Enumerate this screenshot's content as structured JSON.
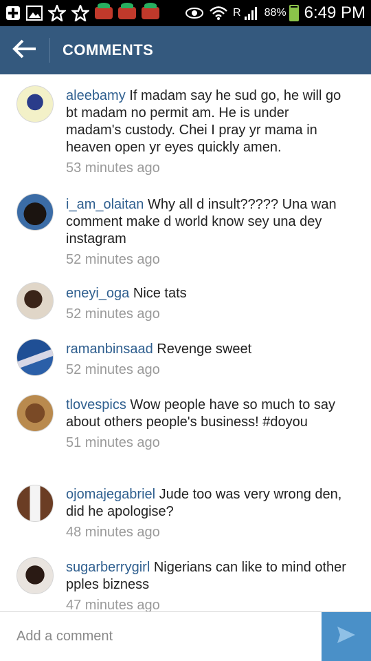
{
  "status_bar": {
    "battery": "88%",
    "battery_level": 0.88,
    "network_label": "R",
    "time": "6:49 PM"
  },
  "header": {
    "title": "COMMENTS"
  },
  "comments": [
    {
      "username": "aleebamy",
      "text": " If madam say he sud go, he will go bt madam no permit am. He is under madam's custody. Chei  I pray yr mama in heaven open yr eyes quickly amen.",
      "time": "53 minutes ago"
    },
    {
      "username": "i_am_olaitan",
      "text": " Why all d insult????? Una wan comment make d world know sey una dey instagram",
      "time": "52 minutes ago"
    },
    {
      "username": "eneyi_oga",
      "text": " Nice tats",
      "time": "52 minutes ago"
    },
    {
      "username": "ramanbinsaad",
      "text": " Revenge sweet",
      "time": "52 minutes ago"
    },
    {
      "username": "tlovespics",
      "text": " Wow people have so much to say about others people's business! #doyou",
      "time": "51 minutes ago"
    },
    {
      "username": "ojomajegabriel",
      "text": " Jude too was very wrong den, did he apologise?",
      "time": "48 minutes ago"
    },
    {
      "username": "sugarberrygirl",
      "text": " Nigerians can like to mind other pples bizness",
      "time": "47 minutes ago"
    }
  ],
  "input": {
    "placeholder": "Add a comment",
    "value": ""
  },
  "colors": {
    "action_bar": "#34597e",
    "username": "#2f5f8f",
    "timestamp": "#9a9a9a",
    "send_button": "#4a90c8"
  },
  "icons": {
    "back": "arrow-left-icon",
    "send": "send-icon"
  }
}
